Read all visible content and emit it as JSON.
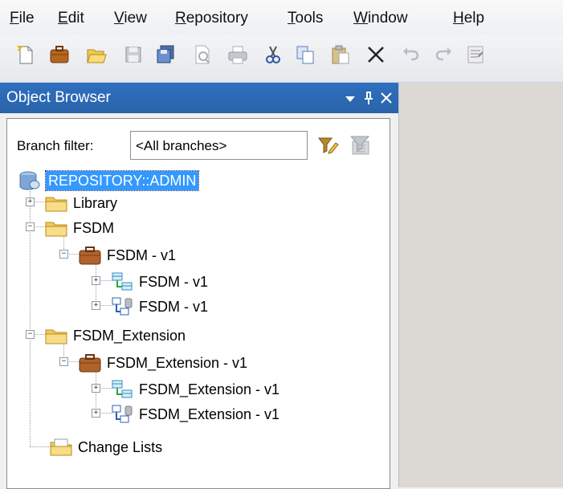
{
  "menu": [
    {
      "label": "File"
    },
    {
      "label": "Edit"
    },
    {
      "label": "View"
    },
    {
      "label": "Repository"
    },
    {
      "label": "Tools"
    },
    {
      "label": "Window"
    },
    {
      "label": "Help"
    }
  ],
  "toolbar": {
    "buttons": [
      {
        "icon": "new-icon"
      },
      {
        "icon": "new-project-icon"
      },
      {
        "icon": "open-icon"
      },
      {
        "icon": "save-icon"
      },
      {
        "icon": "save-all-icon"
      },
      {
        "icon": "print-preview-icon"
      },
      {
        "icon": "print-icon"
      },
      {
        "icon": "cut-icon"
      },
      {
        "icon": "copy-icon"
      },
      {
        "icon": "paste-icon"
      },
      {
        "icon": "delete-icon"
      },
      {
        "icon": "undo-icon"
      },
      {
        "icon": "redo-icon"
      },
      {
        "icon": "properties-icon"
      }
    ]
  },
  "panel": {
    "title": "Object Browser",
    "controls": [
      "dropdown-icon",
      "pin-icon",
      "close-icon"
    ],
    "filter": {
      "label": "Branch filter:",
      "value": "<All branches>"
    },
    "tree": {
      "root": "REPOSITORY::ADMIN",
      "library": "Library",
      "fsdm": "FSDM",
      "fsdm_project": "FSDM - v1",
      "fsdm_model1": "FSDM - v1",
      "fsdm_model2": "FSDM - v1",
      "ext": "FSDM_Extension",
      "ext_project": "FSDM_Extension - v1",
      "ext_model1": "FSDM_Extension - v1",
      "ext_model2": "FSDM_Extension - v1",
      "changelists": "Change Lists"
    }
  },
  "colors": {
    "panel_header": "#2a63aa",
    "selection": "#3399ff"
  }
}
